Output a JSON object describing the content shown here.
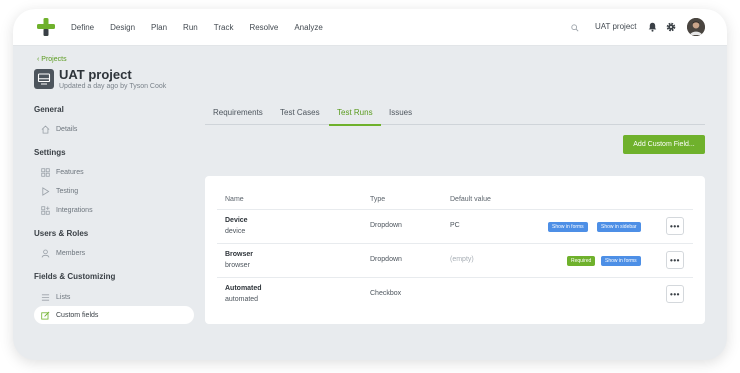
{
  "nav": {
    "items": [
      "Define",
      "Design",
      "Plan",
      "Run",
      "Track",
      "Resolve",
      "Analyze"
    ]
  },
  "header": {
    "project_name": "UAT project"
  },
  "breadcrumb": {
    "back_label": "Projects"
  },
  "project": {
    "title": "UAT project",
    "updated": "Updated a day ago by Tyson Cook"
  },
  "sidebar": {
    "sections": [
      {
        "heading": "General",
        "items": [
          {
            "label": "Details",
            "icon": "home-icon"
          }
        ]
      },
      {
        "heading": "Settings",
        "items": [
          {
            "label": "Features",
            "icon": "grid-icon"
          },
          {
            "label": "Testing",
            "icon": "play-icon"
          },
          {
            "label": "Integrations",
            "icon": "grid-plus-icon"
          }
        ]
      },
      {
        "heading": "Users & Roles",
        "items": [
          {
            "label": "Members",
            "icon": "user-icon"
          }
        ]
      },
      {
        "heading": "Fields & Customizing",
        "items": [
          {
            "label": "Lists",
            "icon": "list-icon"
          },
          {
            "label": "Custom fields",
            "icon": "edit-icon",
            "active": true
          }
        ]
      }
    ]
  },
  "tabs": {
    "items": [
      "Requirements",
      "Test Cases",
      "Test Runs",
      "Issues"
    ],
    "active": "Test Runs"
  },
  "toolbar": {
    "add_label": "Add Custom Field..."
  },
  "table": {
    "headers": {
      "name": "Name",
      "type": "Type",
      "default": "Default value"
    },
    "rows": [
      {
        "name": "Device",
        "key": "device",
        "type": "Dropdown",
        "default": "PC",
        "badges": [
          {
            "label": "Show in forms",
            "color": "blue"
          },
          {
            "label": "Show in sidebar",
            "color": "blue"
          }
        ]
      },
      {
        "name": "Browser",
        "key": "browser",
        "type": "Dropdown",
        "default": "(empty)",
        "badges": [
          {
            "label": "Required",
            "color": "green"
          },
          {
            "label": "Show in forms",
            "color": "blue"
          }
        ]
      },
      {
        "name": "Automated",
        "key": "automated",
        "type": "Checkbox",
        "default": "",
        "badges": []
      }
    ],
    "more_label": "•••"
  },
  "colors": {
    "accent": "#6fb12c",
    "badge_blue": "#4d8fe6",
    "background": "#e8ebee"
  }
}
